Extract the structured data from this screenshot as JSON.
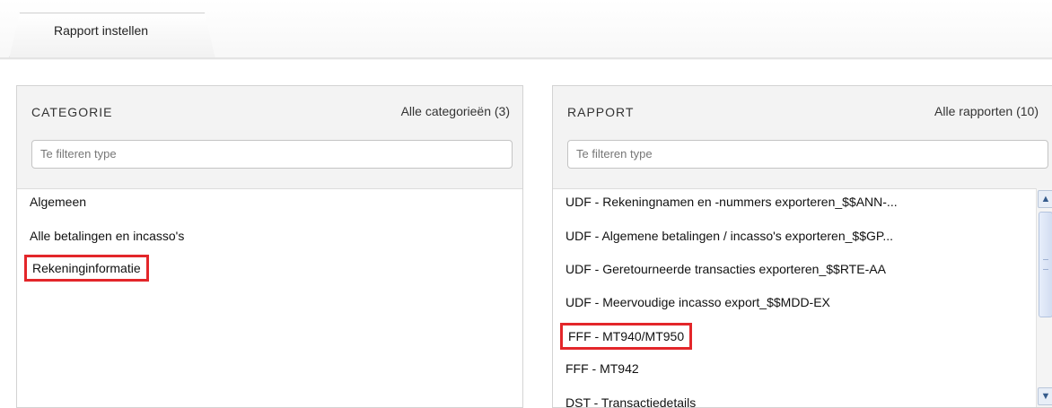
{
  "tabs": [
    {
      "label": "Rapport instellen"
    }
  ],
  "categorie": {
    "title": "CATEGORIE",
    "count_link": "Alle categorieën (3)",
    "filter_placeholder": "Te filteren type",
    "items": [
      {
        "label": "Algemeen"
      },
      {
        "label": "Alle betalingen en incasso's"
      },
      {
        "label": "Rekeninginformatie",
        "highlighted": true
      }
    ]
  },
  "rapport": {
    "title": "RAPPORT",
    "count_link": "Alle rapporten (10)",
    "filter_placeholder": "Te filteren type",
    "items": [
      {
        "label": "UDF - Rekeningnamen en -nummers exporteren_$$ANN-..."
      },
      {
        "label": "UDF - Algemene betalingen / incasso's exporteren_$$GP..."
      },
      {
        "label": "UDF - Geretourneerde transacties exporteren_$$RTE-AA"
      },
      {
        "label": "UDF - Meervoudige incasso export_$$MDD-EX"
      },
      {
        "label": "FFF - MT940/MT950",
        "highlighted": true
      },
      {
        "label": "FFF - MT942"
      },
      {
        "label": "DST - Transactiedetails"
      }
    ]
  },
  "scrollbar": {
    "up_icon": "chevron-up-icon",
    "down_icon": "chevron-down-icon"
  },
  "colors": {
    "highlight": "#e3262a",
    "panel_header": "#f3f3f3"
  }
}
